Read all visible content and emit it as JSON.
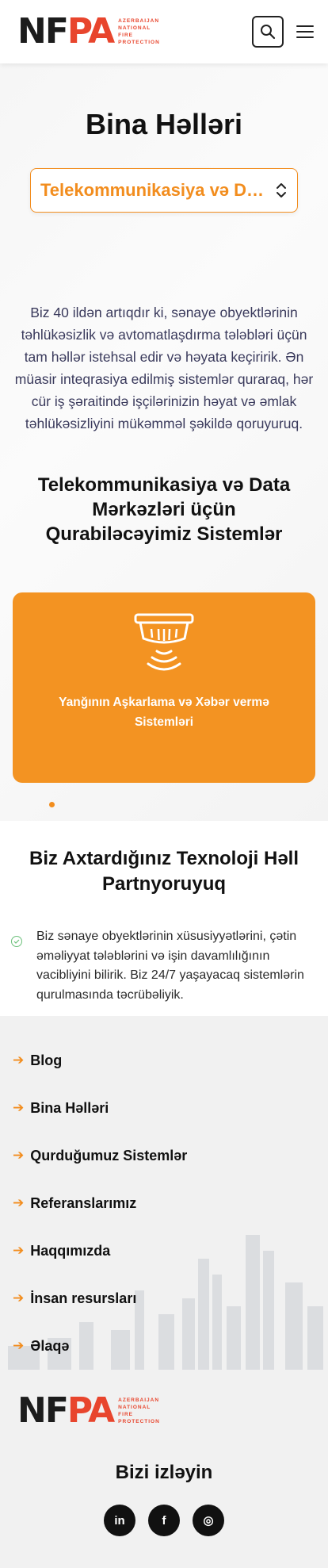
{
  "header": {
    "logo_text": "NFPA",
    "logo_sub": [
      "AZERBAIJAN",
      "NATIONAL",
      "FIRE",
      "PROTECTION"
    ],
    "search_icon": "search-icon",
    "menu_icon": "hamburger-menu-icon"
  },
  "hero": {
    "title": "Bina Həlləri",
    "select_value": "Telekommunikasiya və Data Mərkəzləri",
    "intro": "Biz 40 ildən artıqdır ki, sənaye obyektlərinin təhlükəsizlik və avtomatlaşdırma tələbləri üçün tam həllər istehsal edir və həyata keçiririk. Ən müasir inteqrasiya edilmiş sistemlər quraraq, hər cür iş şəraitində işçilərinizin həyat və əmlak təhlükəsizliyini mükəmməl şəkildə qoruyuruq."
  },
  "systems": {
    "title": "Telekommunikasiya və Data Mərkəzləri üçün Qurabiləcəyimiz Sistemlər",
    "cards": [
      {
        "label": "Yanğının Aşkarlama və Xəbər vermə Sistemləri",
        "icon": "smoke-detector-icon"
      }
    ],
    "active_slide": 1
  },
  "partner": {
    "title": "Biz Axtardığınız Texnoloji Həll Partnyoruyuq",
    "text": "Biz sənaye obyektlərinin xüsusiyyətlərini, çətin əməliyyat tələblərini və işin davamlılığının vacibliyini bilirik. Biz 24/7 yaşayacaq sistemlərin qurulmasında təcrübəliyik."
  },
  "footer": {
    "nav": [
      {
        "label": "Blog"
      },
      {
        "label": "Bina Həlləri"
      },
      {
        "label": "Qurduğumuz Sistemlər"
      },
      {
        "label": "Referanslarımız"
      },
      {
        "label": "Haqqımızda"
      },
      {
        "label": "İnsan resursları"
      },
      {
        "label": "Əlaqə"
      }
    ],
    "follow_title": "Bizi izləyin",
    "socials": [
      {
        "name": "linkedin-icon",
        "glyph": "in"
      },
      {
        "name": "facebook-icon",
        "glyph": "f"
      },
      {
        "name": "instagram-icon",
        "glyph": "◎"
      }
    ]
  },
  "colors": {
    "accent": "#f39322",
    "brand_red": "#e8452d"
  }
}
